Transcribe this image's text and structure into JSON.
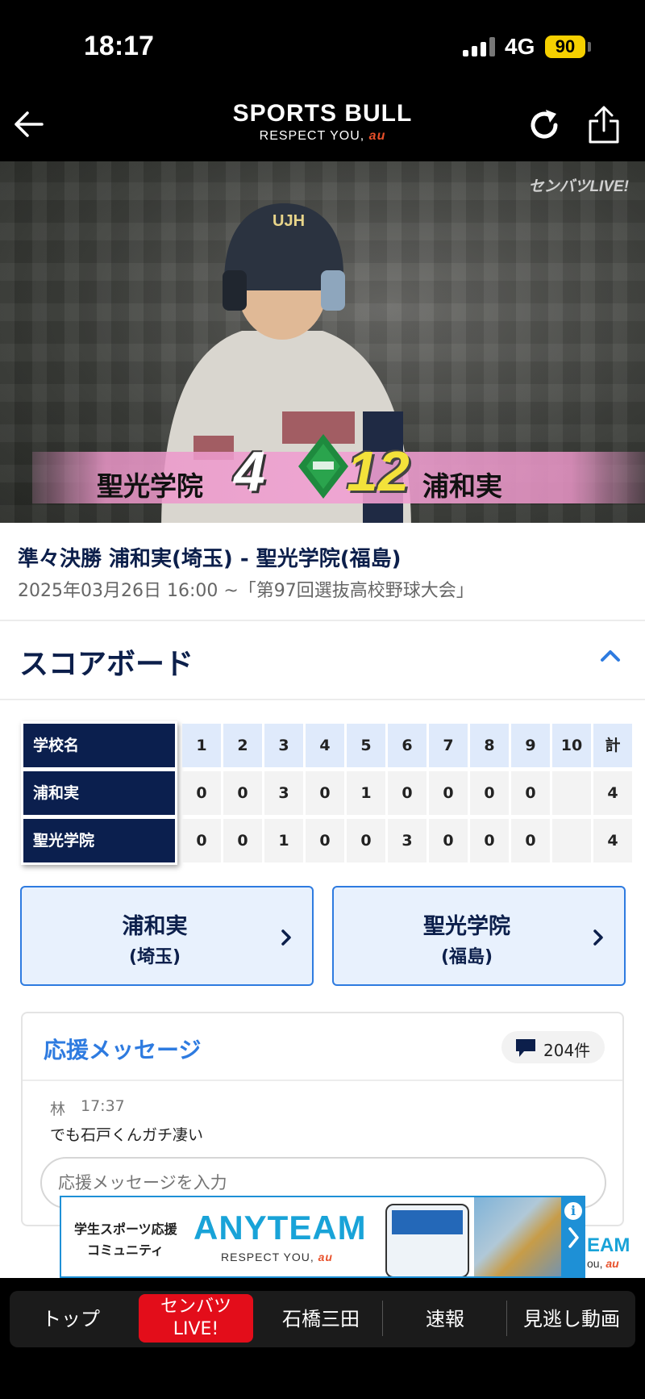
{
  "status_bar": {
    "time": "18:17",
    "network": "4G",
    "battery": "90"
  },
  "header": {
    "logo_main": "SPORTS BULL",
    "logo_sub": "RESPECT YOU,",
    "logo_brand": "au"
  },
  "video": {
    "watermark": "センバツLIVE!",
    "team_left": "聖光学院",
    "score_left": "4",
    "score_right": "12",
    "team_right": "浦和実"
  },
  "game": {
    "title": "準々決勝  浦和実(埼玉) - 聖光学院(福島)",
    "subtitle": "2025年03月26日 16:00 ~「第97回選抜高校野球大会」"
  },
  "scoreboard": {
    "title": "スコアボード",
    "header_label": "学校名",
    "innings": [
      "1",
      "2",
      "3",
      "4",
      "5",
      "6",
      "7",
      "8",
      "9",
      "10",
      "計"
    ],
    "rows": [
      {
        "team": "浦和実",
        "scores": [
          "0",
          "0",
          "3",
          "0",
          "1",
          "0",
          "0",
          "0",
          "0",
          "",
          "4"
        ]
      },
      {
        "team": "聖光学院",
        "scores": [
          "0",
          "0",
          "1",
          "0",
          "0",
          "3",
          "0",
          "0",
          "0",
          "",
          "4"
        ]
      }
    ]
  },
  "teams": [
    {
      "name": "浦和実",
      "prefecture": "(埼玉)"
    },
    {
      "name": "聖光学院",
      "prefecture": "(福島)"
    }
  ],
  "messages": {
    "title": "応援メッセージ",
    "count": "204件",
    "latest": {
      "author": "林",
      "time": "17:37",
      "text": "でも石戸くんガチ凄い"
    },
    "input_placeholder": "応援メッセージを入力"
  },
  "ad": {
    "line1": "学生スポーツ応援",
    "line2": "コミュニティ",
    "brand": "ANYTEAM",
    "tagline": "RESPECT YOU,",
    "tag_brand": "au",
    "info": "i",
    "peek_brand": "EAM",
    "peek_tag": "ou,"
  },
  "bottom_nav": {
    "items": [
      "トップ",
      "石橋三田",
      "速報",
      "見逃し動画"
    ],
    "live_line1": "センバツ",
    "live_line2": "LIVE!"
  }
}
